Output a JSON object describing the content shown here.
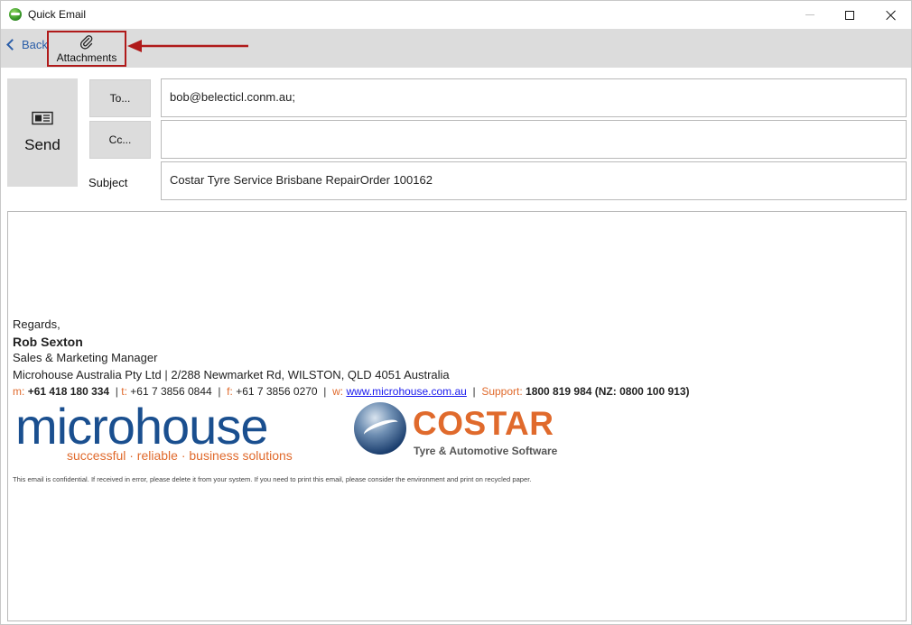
{
  "window": {
    "title": "Quick Email",
    "app_icon": "quick-email-app-icon",
    "controls": [
      "minimize-icon",
      "maximize-icon",
      "close-icon"
    ]
  },
  "toolbar": {
    "back_label": "Back",
    "attachments_label": "Attachments",
    "highlight_color": "#b01a1a",
    "background": "#dcdcdc"
  },
  "compose": {
    "send_label": "Send",
    "to_button": "To...",
    "cc_button": "Cc...",
    "subject_label": "Subject",
    "to_value": "bob@belecticl.conm.au;",
    "cc_value": "",
    "subject_value": "Costar Tyre Service Brisbane RepairOrder 100162"
  },
  "signature": {
    "regards": "Regards,",
    "name": "Rob Sexton",
    "role": "Sales & Marketing Manager",
    "company": "Microhouse Australia Pty Ltd",
    "address": "2/288 Newmarket Rd, WILSTON,  QLD 4051 Australia",
    "mobile_label": "m:",
    "mobile": "+61 418 180 334",
    "phone_label": "t:",
    "phone": "+61 7 3856 0844",
    "fax_label": "f:",
    "fax": "+61 7 3856 0270",
    "web_label": "w:",
    "web": "www.microhouse.com.au",
    "support_label": "Support:",
    "support": "1800 819 984 (NZ: 0800 100 913)",
    "accent_color": "#e06a2c"
  },
  "logos": {
    "microhouse_word": "microhouse",
    "microhouse_tagline": "successful · reliable · business solutions",
    "costar_word": "COSTAR",
    "costar_tagline": "Tyre & Automotive Software"
  },
  "disclaimer": "This email is confidential. If received in error, please delete it from your system. If you need to print this email, please consider the environment and print on recycled paper."
}
